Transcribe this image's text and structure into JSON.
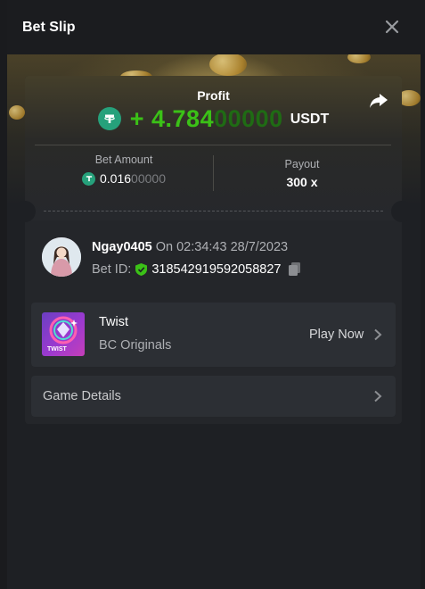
{
  "header": {
    "title": "Bet Slip",
    "close_icon": "close-icon"
  },
  "profit": {
    "label": "Profit",
    "sign": "+ ",
    "value_main": "4.784",
    "value_dim": "00000",
    "currency": "USDT",
    "currency_icon": "usdt-icon",
    "share_icon": "share-icon"
  },
  "stats": {
    "bet_amount_label": "Bet Amount",
    "bet_amount_main": "0.016",
    "bet_amount_dim": "00000",
    "payout_label": "Payout",
    "payout_value": "300 x"
  },
  "user": {
    "name": "Ngay0405",
    "time": " On 02:34:43 28/7/2023",
    "bet_id_label": "Bet ID:",
    "bet_id": "318542919592058827"
  },
  "game": {
    "name": "Twist",
    "provider": "BC Originals",
    "play_label": "Play Now",
    "thumb_text": "TWIST"
  },
  "details": {
    "label": "Game Details"
  },
  "colors": {
    "profit_green": "#3bc117",
    "usdt": "#26a17b",
    "panel": "#24262a"
  }
}
